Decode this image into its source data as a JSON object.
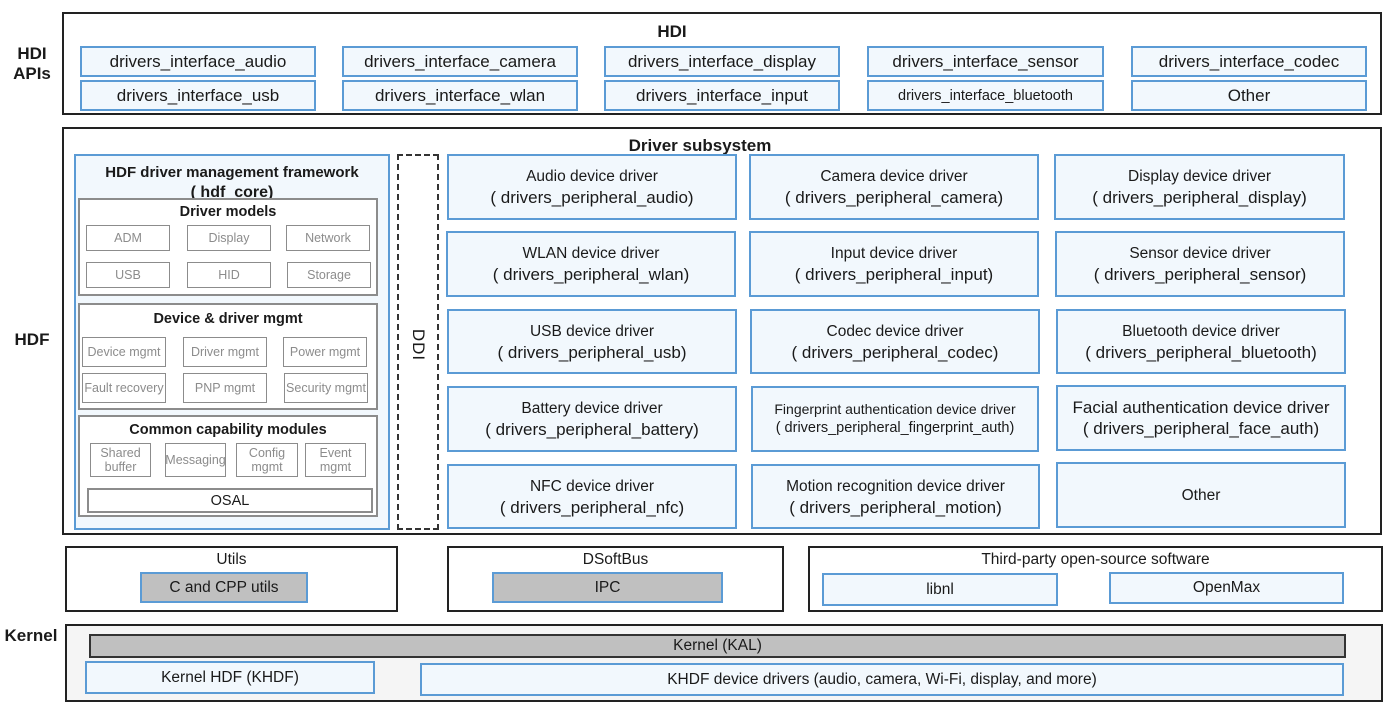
{
  "side_labels": {
    "hdi_apis": "HDI\nAPIs",
    "hdi_apis_line1": "HDI",
    "hdi_apis_line2": "APIs",
    "hdf": "HDF",
    "kernel": "Kernel"
  },
  "hdi": {
    "title": "HDI",
    "row1": [
      "drivers_interface_audio",
      "drivers_interface_camera",
      "drivers_interface_display",
      "drivers_interface_sensor",
      "drivers_interface_codec"
    ],
    "row2": [
      "drivers_interface_usb",
      "drivers_interface_wlan",
      "drivers_interface_input",
      "drivers_interface_bluetooth",
      "Other"
    ]
  },
  "driver_subsystem": {
    "title": "Driver subsystem",
    "framework": {
      "title_line1": "HDF driver management framework",
      "title_line2": "( hdf_core)",
      "driver_models": {
        "title": "Driver models",
        "items": [
          "ADM",
          "Display",
          "Network",
          "USB",
          "HID",
          "Storage"
        ]
      },
      "device_driver_mgmt": {
        "title": "Device & driver mgmt",
        "items": [
          "Device mgmt",
          "Driver mgmt",
          "Power mgmt",
          "Fault recovery",
          "PNP mgmt",
          "Security mgmt"
        ]
      },
      "common_capability": {
        "title": "Common capability modules",
        "items": [
          "Shared buffer",
          "Messaging",
          "Config mgmt",
          "Event mgmt"
        ],
        "osal": "OSAL"
      }
    },
    "ddi_label": "DDI",
    "drivers": [
      {
        "name": "Audio device driver",
        "module": "( drivers_peripheral_audio)"
      },
      {
        "name": "Camera device driver",
        "module": "( drivers_peripheral_camera)"
      },
      {
        "name": "Display device driver",
        "module": "( drivers_peripheral_display)"
      },
      {
        "name": "WLAN device driver",
        "module": "( drivers_peripheral_wlan)"
      },
      {
        "name": "Input device driver",
        "module": "( drivers_peripheral_input)"
      },
      {
        "name": "Sensor device driver",
        "module": "( drivers_peripheral_sensor)"
      },
      {
        "name": "USB device driver",
        "module": "( drivers_peripheral_usb)"
      },
      {
        "name": "Codec device driver",
        "module": "( drivers_peripheral_codec)"
      },
      {
        "name": "Bluetooth device driver",
        "module": "( drivers_peripheral_bluetooth)"
      },
      {
        "name": "Battery device driver",
        "module": "( drivers_peripheral_battery)"
      },
      {
        "name": "Fingerprint authentication device driver",
        "module": "( drivers_peripheral_fingerprint_auth)"
      },
      {
        "name": "Facial authentication device driver",
        "module": "( drivers_peripheral_face_auth)"
      },
      {
        "name": "NFC device driver",
        "module": "( drivers_peripheral_nfc)"
      },
      {
        "name": "Motion recognition device driver",
        "module": "( drivers_peripheral_motion)"
      },
      {
        "name": "Other",
        "module": ""
      }
    ]
  },
  "utils": {
    "title": "Utils",
    "item": "C and CPP utils"
  },
  "dsoftbus": {
    "title": "DSoftBus",
    "item": "IPC"
  },
  "third_party": {
    "title": "Third-party open-source software",
    "items": [
      "libnl",
      "OpenMax"
    ]
  },
  "kernel": {
    "kal": "Kernel (KAL)",
    "khdf": "Kernel HDF (KHDF)",
    "khdf_drivers": "KHDF device drivers (audio, camera, Wi-Fi, display, and more)"
  },
  "colors": {
    "blue_border": "#5b9bd5",
    "blue_fill": "#f2f8fd",
    "gray_fill": "#c0c0c0",
    "gray_text": "#8c8c8c"
  }
}
